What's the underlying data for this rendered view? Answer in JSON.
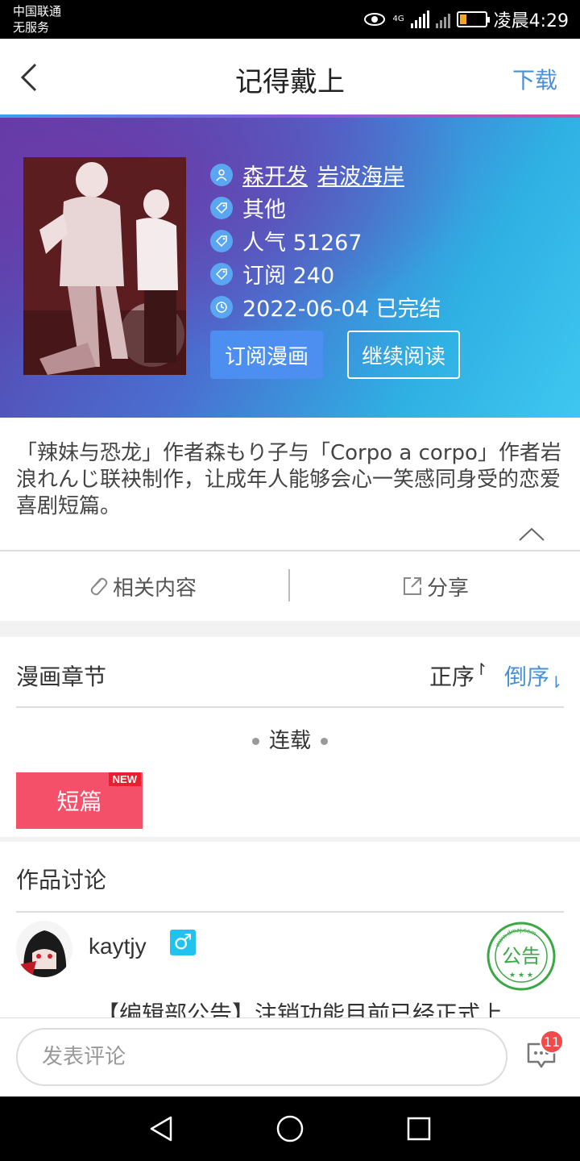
{
  "status": {
    "carrier_line1": "中国联通",
    "carrier_line2": "无服务",
    "net_tag": "4G",
    "time": "凌晨4:29"
  },
  "header": {
    "title": "记得戴上",
    "download_label": "下载"
  },
  "comic": {
    "authors": [
      "森开发",
      "岩波海岸"
    ],
    "category": "其他",
    "popularity": "人气 51267",
    "subscriptions": "订阅 240",
    "date_status": "2022-06-04 已完结",
    "subscribe_button": "订阅漫画",
    "continue_button": "继续阅读"
  },
  "description": "「辣妹与恐龙」作者森もり子与「Corpo a corpo」作者岩浪れんじ联袂制作，让成年人能够会心一笑感同身受的恋爱喜剧短篇。",
  "actions": {
    "related": "相关内容",
    "share": "分享"
  },
  "chapters": {
    "section_title": "漫画章节",
    "order_asc": "正序",
    "order_desc": "倒序",
    "group_label": "连载",
    "items": [
      {
        "label": "短篇",
        "badge": "NEW"
      }
    ]
  },
  "discussion": {
    "section_title": "作品讨论",
    "post": {
      "username": "kaytjy",
      "gender_symbol": "♂",
      "stamp_text": "公告",
      "stamp_url_text": "www.dmzj.com",
      "content": "【编辑部公告】注销功能目前已经正式上"
    }
  },
  "comment_bar": {
    "placeholder": "发表评论",
    "message_count": "11"
  },
  "colors": {
    "accent_blue": "#4a90d9",
    "chapter_red": "#f5506a",
    "badge_red": "#e8202e",
    "gender_cyan": "#1fc3ee",
    "stamp_green": "#3aa844"
  }
}
